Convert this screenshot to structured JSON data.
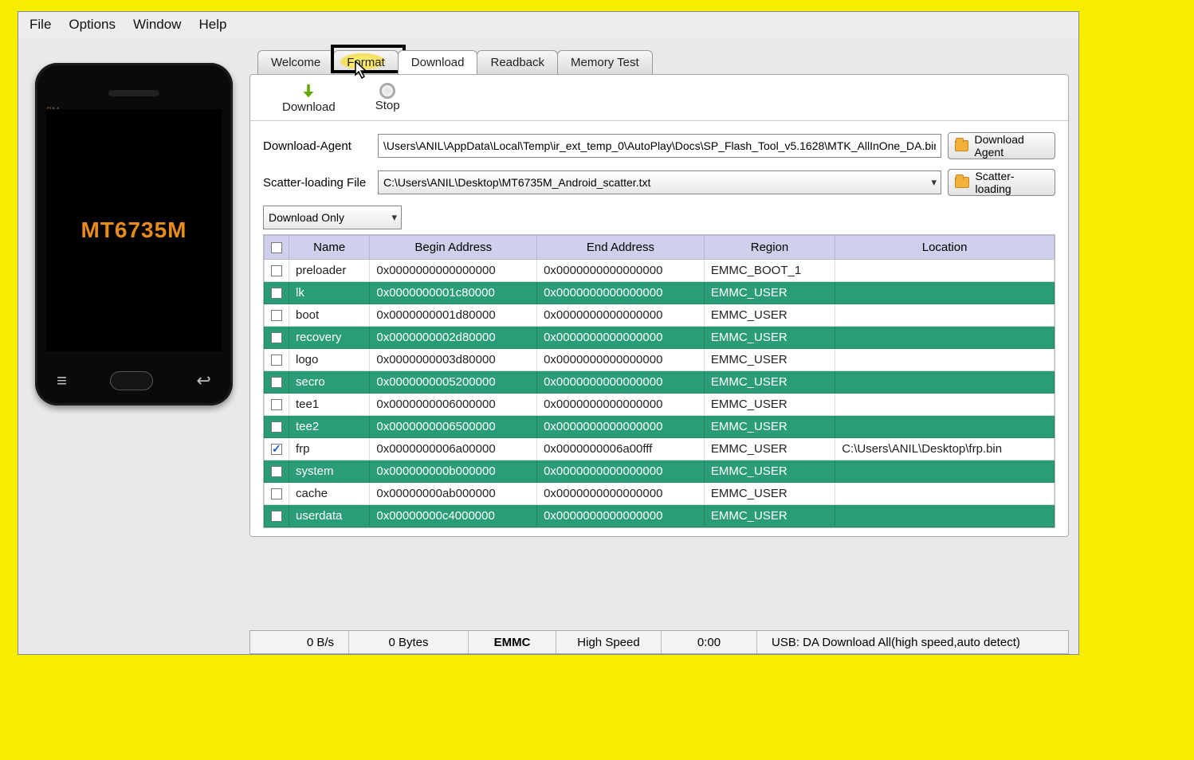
{
  "menu": {
    "file": "File",
    "options": "Options",
    "window": "Window",
    "help": "Help"
  },
  "phone": {
    "bm": "BM",
    "chip": "MT6735M"
  },
  "tabs": {
    "welcome": "Welcome",
    "format": "Format",
    "download": "Download",
    "readback": "Readback",
    "memory": "Memory Test"
  },
  "toolbar": {
    "download": "Download",
    "stop": "Stop"
  },
  "form": {
    "da_label": "Download-Agent",
    "da_value": "\\Users\\ANIL\\AppData\\Local\\Temp\\ir_ext_temp_0\\AutoPlay\\Docs\\SP_Flash_Tool_v5.1628\\MTK_AllInOne_DA.bin",
    "da_btn": "Download Agent",
    "scatter_label": "Scatter-loading File",
    "scatter_value": "C:\\Users\\ANIL\\Desktop\\MT6735M_Android_scatter.txt",
    "scatter_btn": "Scatter-loading",
    "mode": "Download Only"
  },
  "cols": {
    "name": "Name",
    "begin": "Begin Address",
    "end": "End Address",
    "region": "Region",
    "location": "Location"
  },
  "rows": [
    {
      "chk": false,
      "name": "preloader",
      "begin": "0x0000000000000000",
      "end": "0x0000000000000000",
      "region": "EMMC_BOOT_1",
      "loc": ""
    },
    {
      "chk": false,
      "name": "lk",
      "begin": "0x0000000001c80000",
      "end": "0x0000000000000000",
      "region": "EMMC_USER",
      "loc": "",
      "green": true
    },
    {
      "chk": false,
      "name": "boot",
      "begin": "0x0000000001d80000",
      "end": "0x0000000000000000",
      "region": "EMMC_USER",
      "loc": ""
    },
    {
      "chk": false,
      "name": "recovery",
      "begin": "0x0000000002d80000",
      "end": "0x0000000000000000",
      "region": "EMMC_USER",
      "loc": "",
      "green": true
    },
    {
      "chk": false,
      "name": "logo",
      "begin": "0x0000000003d80000",
      "end": "0x0000000000000000",
      "region": "EMMC_USER",
      "loc": ""
    },
    {
      "chk": false,
      "name": "secro",
      "begin": "0x0000000005200000",
      "end": "0x0000000000000000",
      "region": "EMMC_USER",
      "loc": "",
      "green": true
    },
    {
      "chk": false,
      "name": "tee1",
      "begin": "0x0000000006000000",
      "end": "0x0000000000000000",
      "region": "EMMC_USER",
      "loc": ""
    },
    {
      "chk": false,
      "name": "tee2",
      "begin": "0x0000000006500000",
      "end": "0x0000000000000000",
      "region": "EMMC_USER",
      "loc": "",
      "green": true
    },
    {
      "chk": true,
      "name": "frp",
      "begin": "0x0000000006a00000",
      "end": "0x0000000006a00fff",
      "region": "EMMC_USER",
      "loc": "C:\\Users\\ANIL\\Desktop\\frp.bin"
    },
    {
      "chk": false,
      "name": "system",
      "begin": "0x000000000b000000",
      "end": "0x0000000000000000",
      "region": "EMMC_USER",
      "loc": "",
      "green": true
    },
    {
      "chk": false,
      "name": "cache",
      "begin": "0x00000000ab000000",
      "end": "0x0000000000000000",
      "region": "EMMC_USER",
      "loc": ""
    },
    {
      "chk": false,
      "name": "userdata",
      "begin": "0x00000000c4000000",
      "end": "0x0000000000000000",
      "region": "EMMC_USER",
      "loc": "",
      "green": true
    }
  ],
  "status": {
    "rate": "0 B/s",
    "bytes": "0 Bytes",
    "storage": "EMMC",
    "speed": "High Speed",
    "time": "0:00",
    "usb": "USB: DA Download All(high speed,auto detect)"
  }
}
